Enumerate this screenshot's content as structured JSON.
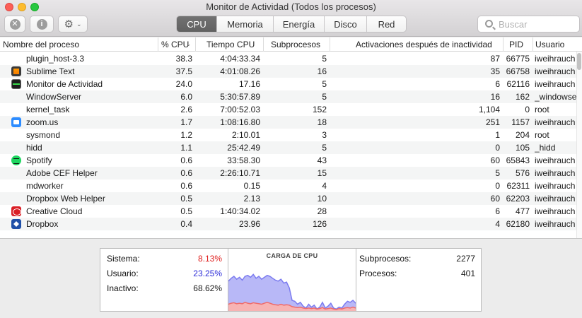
{
  "window": {
    "title": "Monitor de Actividad (Todos los procesos)"
  },
  "toolbar": {
    "close_icon_glyph": "✕",
    "info_icon_glyph": "i",
    "gear_glyph": "⚙",
    "chevron_glyph": "⌄",
    "tabs": [
      {
        "label": "CPU",
        "active": true
      },
      {
        "label": "Memoria",
        "active": false
      },
      {
        "label": "Energía",
        "active": false
      },
      {
        "label": "Disco",
        "active": false
      },
      {
        "label": "Red",
        "active": false
      }
    ],
    "search_placeholder": "Buscar"
  },
  "table": {
    "columns": [
      {
        "label": "Nombre del proceso"
      },
      {
        "label": "% CPU",
        "sorted": true,
        "sort_glyph": "⌄"
      },
      {
        "label": "Tiempo CPU"
      },
      {
        "label": "Subprocesos"
      },
      {
        "label": "Activaciones después de inactividad"
      },
      {
        "label": "PID"
      },
      {
        "label": "Usuario"
      }
    ],
    "rows": [
      {
        "name": "plugin_host-3.3",
        "icon": "",
        "cpu": "38.3",
        "time": "4:04:33.34",
        "threads": "5",
        "wakeups": "87",
        "pid": "66775",
        "user": "iweihrauch"
      },
      {
        "name": "Sublime Text",
        "icon": "sublime-text-icon",
        "cpu": "37.5",
        "time": "4:01:08.26",
        "threads": "16",
        "wakeups": "35",
        "pid": "66758",
        "user": "iweihrauch"
      },
      {
        "name": "Monitor de Actividad",
        "icon": "activity-monitor-icon",
        "cpu": "24.0",
        "time": "17.16",
        "threads": "5",
        "wakeups": "6",
        "pid": "62116",
        "user": "iweihrauch"
      },
      {
        "name": "WindowServer",
        "icon": "",
        "cpu": "6.0",
        "time": "5:30:57.89",
        "threads": "5",
        "wakeups": "16",
        "pid": "162",
        "user": "_windowserver"
      },
      {
        "name": "kernel_task",
        "icon": "",
        "cpu": "2.6",
        "time": "7:00:52.03",
        "threads": "152",
        "wakeups": "1,104",
        "pid": "0",
        "user": "root"
      },
      {
        "name": "zoom.us",
        "icon": "zoom-icon",
        "cpu": "1.7",
        "time": "1:08:16.80",
        "threads": "18",
        "wakeups": "251",
        "pid": "1157",
        "user": "iweihrauch"
      },
      {
        "name": "sysmond",
        "icon": "",
        "cpu": "1.2",
        "time": "2:10.01",
        "threads": "3",
        "wakeups": "1",
        "pid": "204",
        "user": "root"
      },
      {
        "name": "hidd",
        "icon": "",
        "cpu": "1.1",
        "time": "25:42.49",
        "threads": "5",
        "wakeups": "0",
        "pid": "105",
        "user": "_hidd"
      },
      {
        "name": "Spotify",
        "icon": "spotify-icon",
        "cpu": "0.6",
        "time": "33:58.30",
        "threads": "43",
        "wakeups": "60",
        "pid": "65843",
        "user": "iweihrauch"
      },
      {
        "name": "Adobe CEF Helper",
        "icon": "",
        "cpu": "0.6",
        "time": "2:26:10.71",
        "threads": "15",
        "wakeups": "5",
        "pid": "576",
        "user": "iweihrauch"
      },
      {
        "name": "mdworker",
        "icon": "",
        "cpu": "0.6",
        "time": "0.15",
        "threads": "4",
        "wakeups": "0",
        "pid": "62311",
        "user": "iweihrauch"
      },
      {
        "name": "Dropbox Web Helper",
        "icon": "",
        "cpu": "0.5",
        "time": "2.13",
        "threads": "10",
        "wakeups": "60",
        "pid": "62203",
        "user": "iweihrauch"
      },
      {
        "name": "Creative Cloud",
        "icon": "creative-cloud-icon",
        "cpu": "0.5",
        "time": "1:40:34.02",
        "threads": "28",
        "wakeups": "6",
        "pid": "477",
        "user": "iweihrauch"
      },
      {
        "name": "Dropbox",
        "icon": "dropbox-icon",
        "cpu": "0.4",
        "time": "23.96",
        "threads": "126",
        "wakeups": "4",
        "pid": "62180",
        "user": "iweihrauch"
      }
    ]
  },
  "summary": {
    "system_label": "Sistema:",
    "system_value": "8.13%",
    "system_color": "#e0201f",
    "user_label": "Usuario:",
    "user_value": "23.25%",
    "user_color": "#2a2ad8",
    "idle_label": "Inactivo:",
    "idle_value": "68.62%",
    "graph_title": "CARGA DE CPU",
    "threads_label": "Subprocesos:",
    "threads_value": "2277",
    "processes_label": "Procesos:",
    "processes_value": "401"
  },
  "chart_data": {
    "type": "area",
    "title": "CARGA DE CPU",
    "ylim": [
      0,
      100
    ],
    "series": [
      {
        "name": "Usuario",
        "color": "#7b7bf0",
        "values": [
          62,
          68,
          72,
          66,
          70,
          64,
          72,
          74,
          70,
          76,
          68,
          72,
          66,
          70,
          74,
          72,
          68,
          64,
          62,
          66,
          58,
          60,
          48,
          22,
          20,
          14,
          18,
          10,
          6,
          14,
          8,
          12,
          4,
          8,
          18,
          6,
          10,
          16,
          6,
          4,
          8,
          6,
          14,
          20,
          18,
          22,
          16
        ]
      },
      {
        "name": "Sistema",
        "color": "#ef6b6b",
        "values": [
          14,
          16,
          17,
          15,
          16,
          15,
          18,
          16,
          15,
          17,
          16,
          15,
          14,
          16,
          18,
          16,
          14,
          13,
          12,
          14,
          12,
          13,
          12,
          9,
          8,
          7,
          8,
          6,
          5,
          6,
          5,
          6,
          4,
          5,
          7,
          4,
          5,
          6,
          4,
          3,
          5,
          4,
          6,
          7,
          6,
          8,
          6
        ]
      }
    ]
  }
}
